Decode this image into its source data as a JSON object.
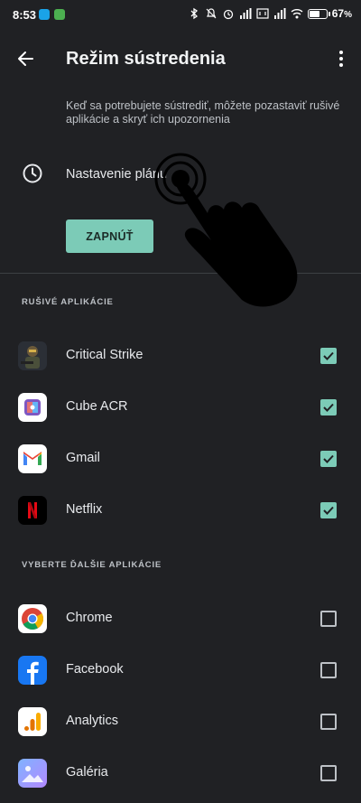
{
  "status_bar": {
    "time": "8:53",
    "battery_percent": "67",
    "battery_level": 0.67,
    "icons": [
      "skype-icon",
      "chat-app-icon",
      "bluetooth-icon",
      "mute-icon",
      "alarm-icon",
      "signal-icon",
      "signal-icon",
      "data-icon",
      "signal-icon",
      "wifi-icon",
      "battery-icon"
    ]
  },
  "header": {
    "title": "Režim sústredenia",
    "back_icon": "arrow-left-icon",
    "more_icon": "more-vertical-icon"
  },
  "description": "Keď sa potrebujete sústrediť, môžete pozastaviť rušivé aplikácie a skryť ich upozornenia",
  "schedule": {
    "label": "Nastavenie plánu",
    "icon": "clock-icon"
  },
  "enable_button": "ZAPNÚŤ",
  "sections": {
    "distracting_title": "RUŠIVÉ APLIKÁCIE",
    "distracting_apps": [
      {
        "name": "Critical Strike",
        "checked": true,
        "icon": "critical-strike-icon"
      },
      {
        "name": "Cube ACR",
        "checked": true,
        "icon": "cube-acr-icon"
      },
      {
        "name": "Gmail",
        "checked": true,
        "icon": "gmail-icon"
      },
      {
        "name": "Netflix",
        "checked": true,
        "icon": "netflix-icon"
      }
    ],
    "more_title": "VYBERTE ĎALŠIE APLIKÁCIE",
    "more_apps": [
      {
        "name": "Chrome",
        "checked": false,
        "icon": "chrome-icon"
      },
      {
        "name": "Facebook",
        "checked": false,
        "icon": "facebook-icon"
      },
      {
        "name": "Analytics",
        "checked": false,
        "icon": "analytics-icon"
      },
      {
        "name": "Galéria",
        "checked": false,
        "icon": "gallery-icon"
      }
    ]
  },
  "colors": {
    "background": "#202124",
    "accent": "#7ccbb7",
    "divider": "#3c4043"
  }
}
